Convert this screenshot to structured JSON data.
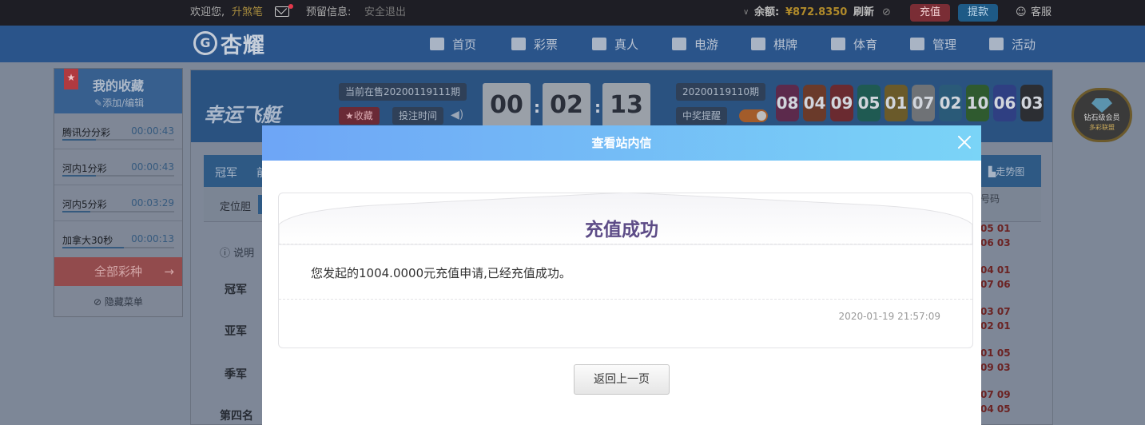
{
  "topbar": {
    "welcome": "欢迎您,",
    "username": "升煞笔",
    "reserved_info": "预留信息:",
    "logout": "安全退出",
    "balance_label": "余额:",
    "balance_value": "¥872.8350",
    "refresh": "刷新",
    "recharge": "充值",
    "withdraw": "提款",
    "service": "客服"
  },
  "brand": {
    "logo_mark": "G",
    "logo_text": "杏耀"
  },
  "nav": [
    {
      "label": "首页",
      "icon": "home-icon"
    },
    {
      "label": "彩票",
      "icon": "ticket-icon"
    },
    {
      "label": "真人",
      "icon": "dealer-icon"
    },
    {
      "label": "电游",
      "icon": "slot-machine-icon"
    },
    {
      "label": "棋牌",
      "icon": "cards-icon"
    },
    {
      "label": "体育",
      "icon": "trophy-icon"
    },
    {
      "label": "管理",
      "icon": "users-icon"
    },
    {
      "label": "活动",
      "icon": "gift-icon"
    }
  ],
  "favorites": {
    "title": "我的收藏",
    "edit": "添加/编辑",
    "items": [
      {
        "name": "腾讯分分彩",
        "time": "00:00:43",
        "progress": 0.3
      },
      {
        "name": "河内1分彩",
        "time": "00:00:43",
        "progress": 0.3
      },
      {
        "name": "河内5分彩",
        "time": "00:03:29",
        "progress": 0.25
      },
      {
        "name": "加拿大30秒",
        "time": "00:00:13",
        "progress": 0.55
      }
    ],
    "all_lotteries": "全部彩种",
    "hide_menu": "隐藏菜单"
  },
  "lottery": {
    "name": "幸运飞艇",
    "current_period": "当前在售20200119111期",
    "collect": "收藏",
    "bet_time": "投注时间",
    "countdown": [
      "00",
      "02",
      "13"
    ],
    "last_period": "20200119110期",
    "win_alert": "中奖提醒",
    "balls": [
      {
        "n": "08",
        "c": "#5c2a4c"
      },
      {
        "n": "04",
        "c": "#6a3a2a"
      },
      {
        "n": "09",
        "c": "#6a2a30"
      },
      {
        "n": "05",
        "c": "#1f5a52"
      },
      {
        "n": "01",
        "c": "#6a5a2a"
      },
      {
        "n": "07",
        "c": "#6f7276"
      },
      {
        "n": "02",
        "c": "#2a5a78"
      },
      {
        "n": "10",
        "c": "#2f5a2f"
      },
      {
        "n": "06",
        "c": "#2f3f82"
      },
      {
        "n": "03",
        "c": "#2c2e33"
      }
    ],
    "tab_first": "冠军",
    "tab_second_partial": "前",
    "trend": "走势图",
    "sub_label": "定位胆",
    "right_head_partial": "号码",
    "explain": "说明",
    "rows": [
      "冠军",
      "亚军",
      "季军",
      "第四名"
    ],
    "right_numbers": [
      [
        "05 01",
        "06 03"
      ],
      [
        "04 01",
        "07 06"
      ],
      [
        "03 07",
        "02 01"
      ],
      [
        "01 05",
        "09 03"
      ],
      [
        "07 09",
        "04 05"
      ]
    ]
  },
  "vip_badge": {
    "line1": "钻石级会员",
    "line2": "多彩联盟"
  },
  "modal": {
    "header": "查看站内信",
    "title": "充值成功",
    "body": "您发起的1004.0000元充值申请,已经充值成功。",
    "time": "2020-01-19 21:57:09",
    "back": "返回上一页"
  },
  "colors": {
    "accent_purple": "#5d4c87",
    "header_gradient_start": "#6ea5f6",
    "header_gradient_end": "#7ad4f7",
    "balance_gold": "#b08a2a"
  }
}
